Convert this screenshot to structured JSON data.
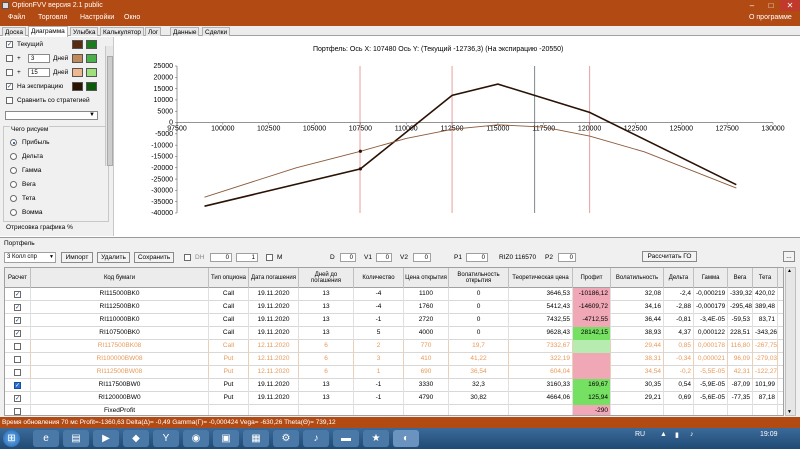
{
  "window": {
    "title": "OptionFVV версия 2.1 public",
    "help": "О программе"
  },
  "menu": [
    "Файл",
    "Торговля",
    "Настройки",
    "Окно"
  ],
  "tabs": [
    "Доска",
    "Диаграмма",
    "Улыбка",
    "Калькулятор",
    "Лог",
    "Данные",
    "Сделки"
  ],
  "left_panel": {
    "current": "Текущий",
    "plus1": "+",
    "plus1_val": "3",
    "days1": "Дней",
    "plus2": "+",
    "plus2_val": "15",
    "days2": "Дней",
    "expiration": "На экспирацию",
    "compare": "Сравнить со стратегией",
    "what_group": "Чего рисуем",
    "radios": [
      "Прибыль",
      "Дельта",
      "Гамма",
      "Вега",
      "Тета",
      "Вомма"
    ],
    "render_label": "Отрисовка графика %",
    "colors": {
      "current": "#5a2a0e",
      "current2": "#1e7a1e",
      "d3": "#c28a5a",
      "d3b": "#4ab04a",
      "d15": "#f0b78f",
      "d15b": "#9ee07a",
      "exp": "#2a1205",
      "exp2": "#0a5a0a"
    }
  },
  "chart_data": {
    "type": "line",
    "title": "Портфель: Ось X: 107480 Ось Y: (Текущий -12736,3) (На экспирацию -20550)",
    "xlim": [
      97500,
      130000
    ],
    "ylim": [
      -40000,
      25000
    ],
    "x_ticks": [
      "97500",
      "100000",
      "102500",
      "105000",
      "107500",
      "110000",
      "112500",
      "115000",
      "117500",
      "120000",
      "122500",
      "125000",
      "127500",
      "130000"
    ],
    "y_ticks": [
      "25000",
      "20000",
      "15000",
      "10000",
      "5000",
      "0",
      "-5000",
      "-10000",
      "-15000",
      "-20000",
      "-25000",
      "-30000",
      "-35000",
      "-40000"
    ],
    "vlines": [
      {
        "x": 107480,
        "color": "#e8a0a0"
      },
      {
        "x": 112500,
        "color": "#e8a0a0"
      },
      {
        "x": 117000,
        "color": "#7a8a8a"
      },
      {
        "x": 120000,
        "color": "#e8a0a0"
      }
    ],
    "series": [
      {
        "color": "#2a1205",
        "x": [
          99000,
          107500,
          112500,
          115000,
          120000,
          128000
        ],
        "y": [
          -37000,
          -20500,
          12000,
          17000,
          4500,
          -27500
        ]
      },
      {
        "color": "#8a5a3a",
        "x": [
          99000,
          104000,
          107500,
          110000,
          112500,
          115000,
          117500,
          120000,
          123000,
          128000
        ],
        "y": [
          -33000,
          -20000,
          -12700,
          -7000,
          -3000,
          -1000,
          -2000,
          -6000,
          -13000,
          -29000
        ]
      }
    ],
    "points": [
      {
        "x": 107500,
        "y": -12700
      },
      {
        "x": 107500,
        "y": -20500
      }
    ]
  },
  "portfolio": {
    "label": "Портфель",
    "selector": "3 Колл спр",
    "import": "Импорт",
    "delete": "Удалить",
    "save": "Сохранить",
    "dh": "DH",
    "dh_v1": "0",
    "dh_v2": "1",
    "m": "M",
    "d_label": "D",
    "d_val": "0",
    "v1_label": "V1",
    "v1_val": "0",
    "v2_label": "V2",
    "v2_val": "0",
    "p1_label": "P1",
    "p1_val": "0",
    "ri_label": "RIZ0 116570",
    "p2_label": "P2",
    "p2_val": "0",
    "calc": "Рассчитать ГО",
    "more": "..."
  },
  "table": {
    "headers": [
      "Расчет",
      "Код бумаги",
      "Тип опциона",
      "Дата погашения",
      "Дней до погашения",
      "Количество",
      "Цена открытия",
      "Волатильность открытия",
      "Теоретическая цена",
      "Профит",
      "Волатильность",
      "Дельта",
      "Гамма",
      "Вега",
      "Тета",
      "X"
    ],
    "rows": [
      {
        "chk": "✓",
        "code": "RI115000BK0",
        "type": "Call",
        "date": "19.11.2020",
        "days": "13",
        "qty": "-4",
        "price": "1100",
        "vol": "0",
        "theo": "3646,53",
        "profit": "-10186,12",
        "pc": "red",
        "v": "32,08",
        "d": "-2,4",
        "g": "-0,000219",
        "vg": "-339,32",
        "t": "420,02",
        "x": "X",
        "dis": false
      },
      {
        "chk": "✓",
        "code": "RI112500BK0",
        "type": "Call",
        "date": "19.11.2020",
        "days": "13",
        "qty": "-4",
        "price": "1760",
        "vol": "0",
        "theo": "5412,43",
        "profit": "-14609,72",
        "pc": "red",
        "v": "34,16",
        "d": "-2,88",
        "g": "-0,000179",
        "vg": "-295,48",
        "t": "389,48",
        "x": "X",
        "dis": false
      },
      {
        "chk": "✓",
        "code": "RI110000BK0",
        "type": "Call",
        "date": "19.11.2020",
        "days": "13",
        "qty": "-1",
        "price": "2720",
        "vol": "0",
        "theo": "7432,55",
        "profit": "-4712,55",
        "pc": "red",
        "v": "36,44",
        "d": "-0,81",
        "g": "-3,4E-05",
        "vg": "-59,53",
        "t": "83,71",
        "x": "X",
        "dis": false
      },
      {
        "chk": "✓",
        "code": "RI107500BK0",
        "type": "Call",
        "date": "19.11.2020",
        "days": "13",
        "qty": "5",
        "price": "4000",
        "vol": "0",
        "theo": "9628,43",
        "profit": "28142,15",
        "pc": "green",
        "v": "38,93",
        "d": "4,37",
        "g": "0,000122",
        "vg": "228,51",
        "t": "-343,26",
        "x": "X",
        "dis": false
      },
      {
        "chk": "",
        "code": "RI117500BK08",
        "type": "Call",
        "date": "12.11.2020",
        "days": "6",
        "qty": "2",
        "price": "770",
        "vol": "19,7",
        "theo": "7332,67",
        "profit": "",
        "pc": "greenl",
        "v": "29,44",
        "d": "0,85",
        "g": "0,000178",
        "vg": "116,80",
        "t": "-267,75",
        "x": "X",
        "dis": true
      },
      {
        "chk": "",
        "code": "RI100000BW08",
        "type": "Put",
        "date": "12.11.2020",
        "days": "6",
        "qty": "3",
        "price": "410",
        "vol": "41,22",
        "theo": "322,19",
        "profit": "",
        "pc": "red",
        "v": "38,31",
        "d": "-0,34",
        "g": "0,000021",
        "vg": "96,09",
        "t": "-279,03",
        "x": "X",
        "dis": true
      },
      {
        "chk": "",
        "code": "RI112500BW08",
        "type": "Put",
        "date": "12.11.2020",
        "days": "6",
        "qty": "1",
        "price": "690",
        "vol": "36,54",
        "theo": "604,04",
        "profit": "",
        "pc": "red",
        "v": "34,54",
        "d": "-0,2",
        "g": "-5,5E-05",
        "vg": "42,31",
        "t": "-122,27",
        "x": "X",
        "dis": true
      },
      {
        "chk": "✓",
        "code": "RI117500BW0",
        "type": "Put",
        "date": "19.11.2020",
        "days": "13",
        "qty": "-1",
        "price": "3330",
        "vol": "32,3",
        "theo": "3160,33",
        "profit": "169,67",
        "pc": "green",
        "v": "30,35",
        "d": "0,54",
        "g": "-5,9E-05",
        "vg": "-87,09",
        "t": "101,99",
        "x": "X",
        "dis": false,
        "sel": true
      },
      {
        "chk": "✓",
        "code": "RI120000BW0",
        "type": "Put",
        "date": "19.11.2020",
        "days": "13",
        "qty": "-1",
        "price": "4790",
        "vol": "30,82",
        "theo": "4664,06",
        "profit": "125,94",
        "pc": "green",
        "v": "29,21",
        "d": "0,69",
        "g": "-5,6E-05",
        "vg": "-77,35",
        "t": "87,18",
        "x": "X",
        "dis": false
      },
      {
        "chk": "",
        "code": "FixedProfit",
        "type": "",
        "date": "",
        "days": "",
        "qty": "",
        "price": "",
        "vol": "",
        "theo": "",
        "profit": "-290",
        "pc": "red",
        "v": "",
        "d": "",
        "g": "",
        "vg": "",
        "t": "",
        "x": "X",
        "dis": false
      }
    ]
  },
  "status": "Время обновления 70 мс  Profit=-1360,63 Delta(Δ)= -0,49 Gamma(Γ)= -0,000424 Vega= -630,26 Theta(Θ)= 739,12",
  "taskbar": {
    "lang": "RU",
    "time": "19:09"
  }
}
